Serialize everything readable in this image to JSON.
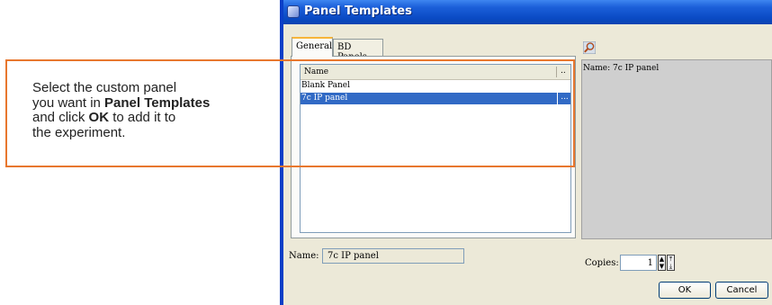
{
  "window": {
    "title": "Panel Templates"
  },
  "tabs": [
    {
      "label": "General",
      "active": true
    },
    {
      "label": "BD Panels",
      "active": false
    }
  ],
  "list": {
    "column_header": "Name",
    "column_more": "..",
    "rows": [
      {
        "name": "Blank Panel",
        "selected": false,
        "more": ""
      },
      {
        "name": "7c IP panel",
        "selected": true,
        "more": "..."
      }
    ]
  },
  "preview": {
    "icon": "magnifier-icon",
    "label": "Name: 7c IP panel"
  },
  "name_field": {
    "label": "Name:",
    "value": "7c IP panel"
  },
  "copies": {
    "label": "Copies:",
    "value": "1"
  },
  "buttons": {
    "ok": "OK",
    "cancel": "Cancel"
  },
  "callout": {
    "line1": "Select the custom panel",
    "line2a": "you want in ",
    "line2b": "Panel Templates",
    "line3a": "and click ",
    "line3b": "OK",
    "line3c": " to add it to",
    "line4": "the experiment."
  },
  "colors": {
    "callout_border": "#e8772e",
    "selection": "#316ac5",
    "titlebar": "#0a4ac4"
  }
}
